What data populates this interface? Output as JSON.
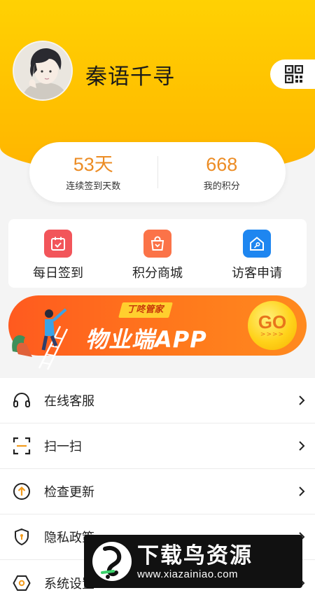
{
  "profile": {
    "username": "秦语千寻"
  },
  "stats": [
    {
      "value": "53天",
      "label": "连续签到天数"
    },
    {
      "value": "668",
      "label": "我的积分"
    }
  ],
  "quick_actions": [
    {
      "label": "每日签到",
      "icon": "calendar-check-icon",
      "color": "#f2555a"
    },
    {
      "label": "积分商城",
      "icon": "shopping-bag-icon",
      "color": "#fb7348"
    },
    {
      "label": "访客申请",
      "icon": "home-key-icon",
      "color": "#1e86f0"
    }
  ],
  "banner": {
    "tag": "丁咚管家",
    "title": "物业端APP",
    "go": "GO",
    "arrows": ">>>>"
  },
  "menu": [
    {
      "label": "在线客服",
      "icon": "headset-icon"
    },
    {
      "label": "扫一扫",
      "icon": "scan-icon"
    },
    {
      "label": "检查更新",
      "icon": "update-arrow-icon"
    },
    {
      "label": "隐私政策",
      "icon": "shield-lock-icon"
    },
    {
      "label": "系统设置",
      "icon": "settings-hex-icon"
    }
  ],
  "watermark": {
    "title": "下载鸟资源",
    "url": "www.xiazainiao.com"
  },
  "colors": {
    "header": "#ffc000",
    "accent_orange": "#ec8c24",
    "banner": "#ff6a1f"
  }
}
